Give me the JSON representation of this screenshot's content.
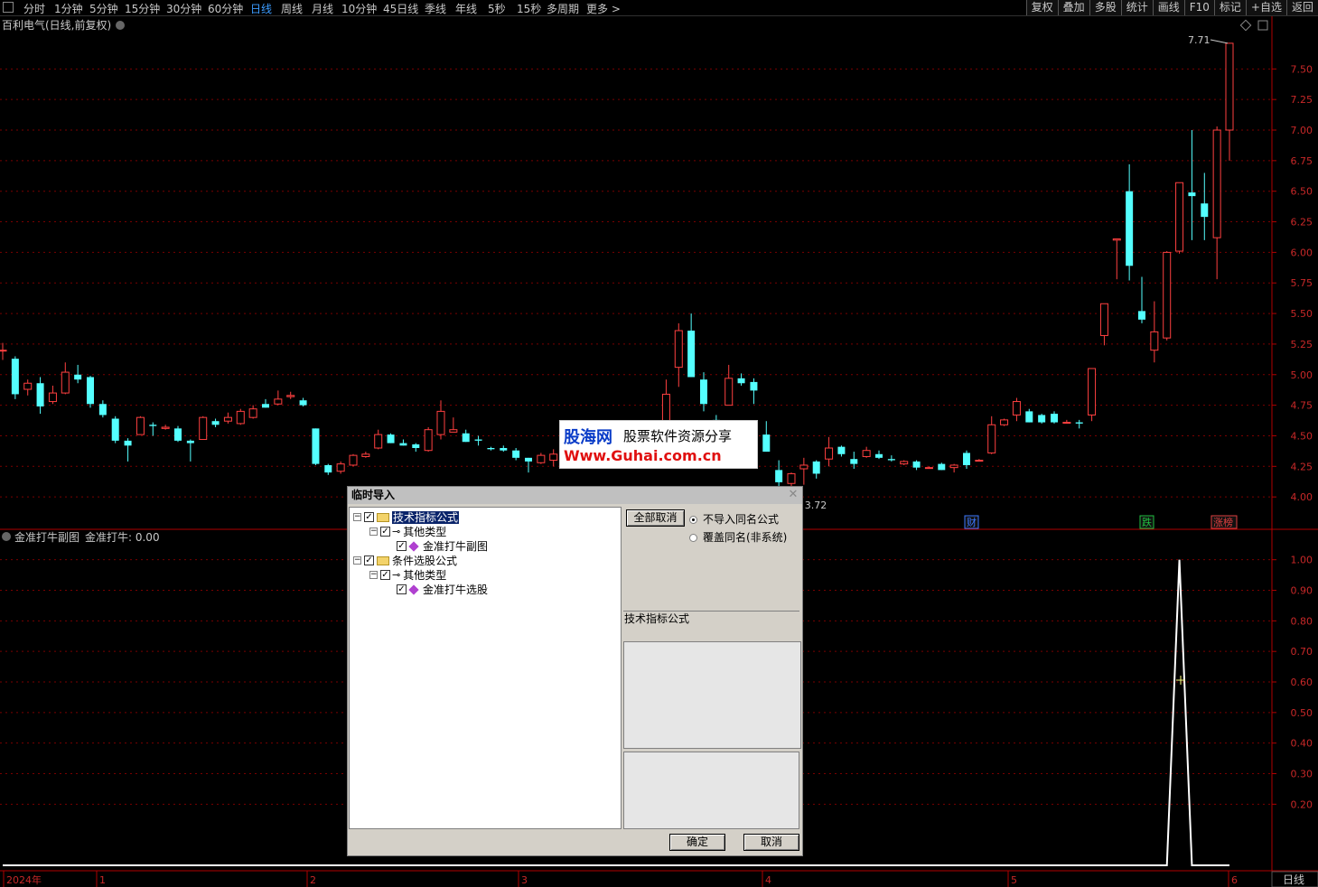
{
  "topbar": {
    "tabs": [
      "分时",
      "1分钟",
      "5分钟",
      "15分钟",
      "30分钟",
      "60分钟",
      "日线",
      "周线",
      "月线",
      "10分钟",
      "45日线",
      "季线",
      "年线",
      "5秒",
      "15秒",
      "多周期",
      "更多 >"
    ],
    "active_tab": "日线",
    "right_buttons": [
      "复权",
      "叠加",
      "多股",
      "统计",
      "画线",
      "F10",
      "标记",
      "+自选",
      "返回"
    ]
  },
  "main_chart": {
    "title": "百利电气(日线,前复权)",
    "high_label": "7.71",
    "low_label": "3.72",
    "y_ticks": [
      "7.50",
      "7.25",
      "7.00",
      "6.75",
      "6.50",
      "6.25",
      "6.00",
      "5.75",
      "5.50",
      "5.25",
      "5.00",
      "4.75",
      "4.50",
      "4.25",
      "4.00"
    ],
    "badges": [
      {
        "text": "财",
        "color": "#3c78ff"
      },
      {
        "text": "跌",
        "color": "#20c040"
      },
      {
        "text": "涨榜",
        "color": "#e04040"
      }
    ]
  },
  "indicator": {
    "title": "金准打牛副图",
    "value_label": "金准打牛: 0.00",
    "y_ticks": [
      "1.00",
      "0.90",
      "0.80",
      "0.70",
      "0.60",
      "0.50",
      "0.40",
      "0.30",
      "0.20"
    ]
  },
  "x_axis": {
    "labels": [
      "2024年",
      "1",
      "2",
      "3",
      "4",
      "5",
      "6"
    ],
    "period_button": "日线"
  },
  "colors": {
    "up": "#ff4040",
    "down": "#54ffff",
    "grid": "#7a0000",
    "axis": "#b00000"
  },
  "watermark": {
    "line1_brand": "股海网",
    "line1_text": "股票软件资源分享",
    "line2": "Www.Guhai.com.cn"
  },
  "dialog": {
    "title": "临时导入",
    "tree": [
      {
        "label": "技术指标公式",
        "type": "folder",
        "level": 0
      },
      {
        "label": "其他类型",
        "type": "key",
        "level": 1
      },
      {
        "label": "金准打牛副图",
        "type": "item",
        "level": 2
      },
      {
        "label": "条件选股公式",
        "type": "folder",
        "level": 0
      },
      {
        "label": "其他类型",
        "type": "key",
        "level": 1
      },
      {
        "label": "金准打牛选股",
        "type": "item",
        "level": 2
      }
    ],
    "cancel_all_button": "全部取消",
    "radio_no_import": "不导入同名公式",
    "radio_overwrite": "覆盖同名(非系统)",
    "selected_group": "技术指标公式",
    "ok_button": "确定",
    "cancel_button": "取消"
  },
  "chart_data": {
    "type": "candlestick",
    "title": "百利电气(日线,前复权)",
    "ylim": [
      3.75,
      7.82
    ],
    "candles": [
      [
        5.2,
        5.2,
        5.26,
        5.12
      ],
      [
        5.13,
        4.84,
        5.15,
        4.8
      ],
      [
        4.88,
        4.93,
        4.96,
        4.83
      ],
      [
        4.93,
        4.74,
        4.98,
        4.68
      ],
      [
        4.78,
        4.85,
        4.91,
        4.76
      ],
      [
        4.85,
        5.02,
        5.1,
        4.84
      ],
      [
        5.0,
        4.96,
        5.08,
        4.93
      ],
      [
        4.98,
        4.76,
        4.99,
        4.73
      ],
      [
        4.76,
        4.67,
        4.79,
        4.65
      ],
      [
        4.64,
        4.46,
        4.66,
        4.44
      ],
      [
        4.46,
        4.42,
        4.48,
        4.29
      ],
      [
        4.51,
        4.65,
        4.66,
        4.51
      ],
      [
        4.59,
        4.58,
        4.61,
        4.5
      ],
      [
        4.56,
        4.57,
        4.59,
        4.55
      ],
      [
        4.56,
        4.46,
        4.58,
        4.45
      ],
      [
        4.46,
        4.44,
        4.47,
        4.29
      ],
      [
        4.47,
        4.65,
        4.66,
        4.47
      ],
      [
        4.62,
        4.59,
        4.64,
        4.57
      ],
      [
        4.62,
        4.65,
        4.69,
        4.6
      ],
      [
        4.6,
        4.7,
        4.72,
        4.59
      ],
      [
        4.65,
        4.72,
        4.75,
        4.64
      ],
      [
        4.76,
        4.73,
        4.8,
        4.73
      ],
      [
        4.76,
        4.8,
        4.87,
        4.75
      ],
      [
        4.82,
        4.83,
        4.86,
        4.8
      ],
      [
        4.79,
        4.75,
        4.81,
        4.74
      ],
      [
        4.56,
        4.27,
        4.56,
        4.26
      ],
      [
        4.26,
        4.2,
        4.27,
        4.18
      ],
      [
        4.21,
        4.27,
        4.29,
        4.19
      ],
      [
        4.26,
        4.34,
        4.35,
        4.25
      ],
      [
        4.33,
        4.35,
        4.37,
        4.32
      ],
      [
        4.4,
        4.51,
        4.55,
        4.39
      ],
      [
        4.51,
        4.44,
        4.52,
        4.44
      ],
      [
        4.44,
        4.42,
        4.47,
        4.42
      ],
      [
        4.43,
        4.4,
        4.44,
        4.37
      ],
      [
        4.38,
        4.55,
        4.57,
        4.37
      ],
      [
        4.51,
        4.7,
        4.79,
        4.47
      ],
      [
        4.53,
        4.55,
        4.65,
        4.53
      ],
      [
        4.52,
        4.45,
        4.55,
        4.45
      ],
      [
        4.47,
        4.46,
        4.5,
        4.42
      ],
      [
        4.4,
        4.39,
        4.41,
        4.38
      ],
      [
        4.4,
        4.38,
        4.42,
        4.37
      ],
      [
        4.38,
        4.32,
        4.4,
        4.3
      ],
      [
        4.32,
        4.29,
        4.32,
        4.2
      ],
      [
        4.28,
        4.34,
        4.36,
        4.27
      ],
      [
        4.3,
        4.35,
        4.39,
        4.25
      ],
      [
        4.34,
        4.32,
        4.35,
        4.31
      ],
      [
        4.35,
        4.37,
        4.38,
        4.34
      ],
      [
        4.35,
        4.33,
        4.38,
        4.3
      ],
      [
        4.48,
        4.48,
        4.52,
        4.46
      ],
      [
        4.51,
        4.51,
        4.54,
        4.5
      ],
      [
        4.5,
        4.5,
        4.53,
        4.48
      ],
      [
        4.5,
        4.55,
        4.57,
        4.49
      ],
      [
        4.55,
        4.44,
        4.57,
        4.36
      ],
      [
        4.51,
        4.84,
        4.96,
        4.58
      ],
      [
        5.06,
        5.36,
        5.42,
        4.9
      ],
      [
        5.36,
        4.98,
        5.5,
        4.98
      ],
      [
        4.96,
        4.76,
        5.02,
        4.7
      ],
      [
        4.63,
        4.58,
        4.67,
        4.53
      ],
      [
        4.75,
        4.97,
        5.08,
        4.75
      ],
      [
        4.97,
        4.93,
        5.01,
        4.91
      ],
      [
        4.94,
        4.87,
        4.97,
        4.76
      ],
      [
        4.51,
        4.37,
        4.62,
        4.37
      ],
      [
        4.22,
        4.12,
        4.3,
        4.02
      ],
      [
        4.11,
        4.19,
        4.2,
        3.72
      ],
      [
        4.23,
        4.26,
        4.32,
        4.1
      ],
      [
        4.29,
        4.19,
        4.3,
        4.15
      ],
      [
        4.31,
        4.4,
        4.49,
        4.25
      ],
      [
        4.41,
        4.35,
        4.42,
        4.33
      ],
      [
        4.31,
        4.27,
        4.37,
        4.23
      ],
      [
        4.33,
        4.38,
        4.41,
        4.32
      ],
      [
        4.35,
        4.32,
        4.38,
        4.31
      ],
      [
        4.31,
        4.3,
        4.34,
        4.29
      ],
      [
        4.27,
        4.29,
        4.3,
        4.26
      ],
      [
        4.29,
        4.24,
        4.3,
        4.22
      ],
      [
        4.24,
        4.24,
        4.25,
        4.24
      ],
      [
        4.27,
        4.22,
        4.28,
        4.22
      ],
      [
        4.24,
        4.26,
        4.27,
        4.2
      ],
      [
        4.36,
        4.26,
        4.38,
        4.23
      ],
      [
        4.3,
        4.3,
        4.31,
        4.29
      ],
      [
        4.36,
        4.59,
        4.66,
        4.35
      ],
      [
        4.59,
        4.63,
        4.64,
        4.58
      ],
      [
        4.67,
        4.78,
        4.81,
        4.62
      ],
      [
        4.7,
        4.61,
        4.72,
        4.61
      ],
      [
        4.67,
        4.61,
        4.68,
        4.6
      ],
      [
        4.68,
        4.61,
        4.7,
        4.6
      ],
      [
        4.61,
        4.61,
        4.63,
        4.6
      ],
      [
        4.61,
        4.6,
        4.63,
        4.56
      ],
      [
        4.67,
        5.05,
        5.05,
        4.62
      ],
      [
        5.32,
        5.58,
        5.58,
        5.24
      ],
      [
        6.1,
        6.11,
        6.11,
        5.78
      ],
      [
        6.5,
        5.89,
        6.72,
        5.77
      ],
      [
        5.52,
        5.45,
        5.8,
        5.42
      ],
      [
        5.2,
        5.35,
        5.6,
        5.1
      ],
      [
        5.3,
        6.0,
        6.01,
        5.28
      ],
      [
        6.01,
        6.57,
        6.57,
        5.99
      ],
      [
        6.49,
        6.46,
        7.0,
        6.1
      ],
      [
        6.4,
        6.29,
        6.65,
        6.1
      ],
      [
        6.12,
        7.0,
        7.03,
        5.78
      ],
      [
        7.0,
        7.71,
        7.71,
        6.75
      ]
    ],
    "indicator_series": {
      "name": "金准打牛",
      "ylim": [
        0,
        1.07
      ],
      "values_by_index": {
        "last5": [
          0,
          1,
          0,
          0,
          0
        ]
      }
    },
    "x_labels": [
      "2024年",
      "1",
      "2",
      "3",
      "4",
      "5",
      "6"
    ]
  }
}
